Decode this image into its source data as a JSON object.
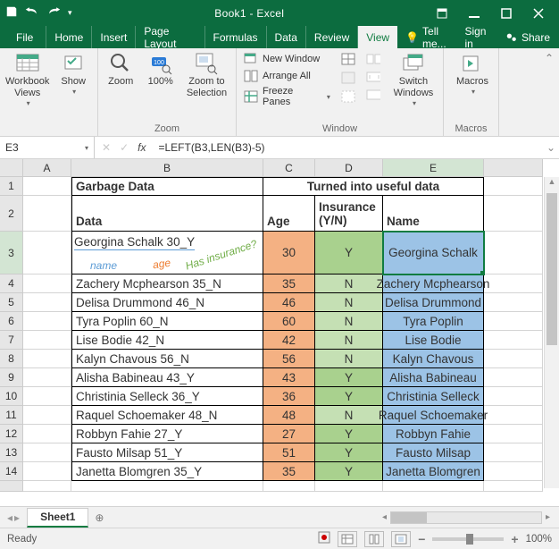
{
  "title": "Book1 - Excel",
  "tabs": {
    "file": "File",
    "home": "Home",
    "insert": "Insert",
    "pagelayout": "Page Layout",
    "formulas": "Formulas",
    "data": "Data",
    "review": "Review",
    "view": "View",
    "tellme": "Tell me...",
    "signin": "Sign in",
    "share": "Share"
  },
  "ribbon": {
    "workbook_views": "Workbook\nViews",
    "show": "Show",
    "zoom_btn": "Zoom",
    "p100": "100%",
    "zoom_sel": "Zoom to\nSelection",
    "zoom_lbl": "Zoom",
    "newwin": "New Window",
    "arrange": "Arrange All",
    "freeze": "Freeze Panes",
    "switch": "Switch\nWindows",
    "window_lbl": "Window",
    "macros": "Macros",
    "macros_lbl": "Macros"
  },
  "namebox": "E3",
  "formula": "=LEFT(B3,LEN(B3)-5)",
  "columns": [
    "A",
    "B",
    "C",
    "D",
    "E"
  ],
  "headers": {
    "h1_b": "Garbage Data",
    "h1_c": "Turned into useful data",
    "h2_b": "Data",
    "h2_c": "Age",
    "h2_d": "Insurance (Y/N)",
    "h2_e": "Name"
  },
  "row3": {
    "data": "Georgina Schalk 30_Y",
    "ann_name": "name",
    "ann_age": "age",
    "ann_ins": "Has insurance?",
    "age": "30",
    "ins": "Y",
    "name": "Georgina Schalk"
  },
  "rows": [
    {
      "data": "Zachery Mcphearson 35_N",
      "age": "35",
      "ins": "N",
      "name": "Zachery Mcphearson"
    },
    {
      "data": "Delisa Drummond 46_N",
      "age": "46",
      "ins": "N",
      "name": "Delisa Drummond"
    },
    {
      "data": "Tyra Poplin 60_N",
      "age": "60",
      "ins": "N",
      "name": "Tyra Poplin"
    },
    {
      "data": "Lise Bodie 42_N",
      "age": "42",
      "ins": "N",
      "name": "Lise Bodie"
    },
    {
      "data": "Kalyn Chavous 56_N",
      "age": "56",
      "ins": "N",
      "name": "Kalyn Chavous"
    },
    {
      "data": "Alisha Babineau 43_Y",
      "age": "43",
      "ins": "Y",
      "name": "Alisha Babineau"
    },
    {
      "data": "Christinia Selleck 36_Y",
      "age": "36",
      "ins": "Y",
      "name": "Christinia Selleck"
    },
    {
      "data": "Raquel Schoemaker 48_N",
      "age": "48",
      "ins": "N",
      "name": "Raquel Schoemaker"
    },
    {
      "data": "Robbyn Fahie 27_Y",
      "age": "27",
      "ins": "Y",
      "name": "Robbyn Fahie"
    },
    {
      "data": "Fausto Milsap 51_Y",
      "age": "51",
      "ins": "Y",
      "name": "Fausto Milsap"
    },
    {
      "data": "Janetta Blomgren 35_Y",
      "age": "35",
      "ins": "Y",
      "name": "Janetta Blomgren"
    }
  ],
  "sheet": "Sheet1",
  "status": "Ready",
  "zoom": "100%"
}
